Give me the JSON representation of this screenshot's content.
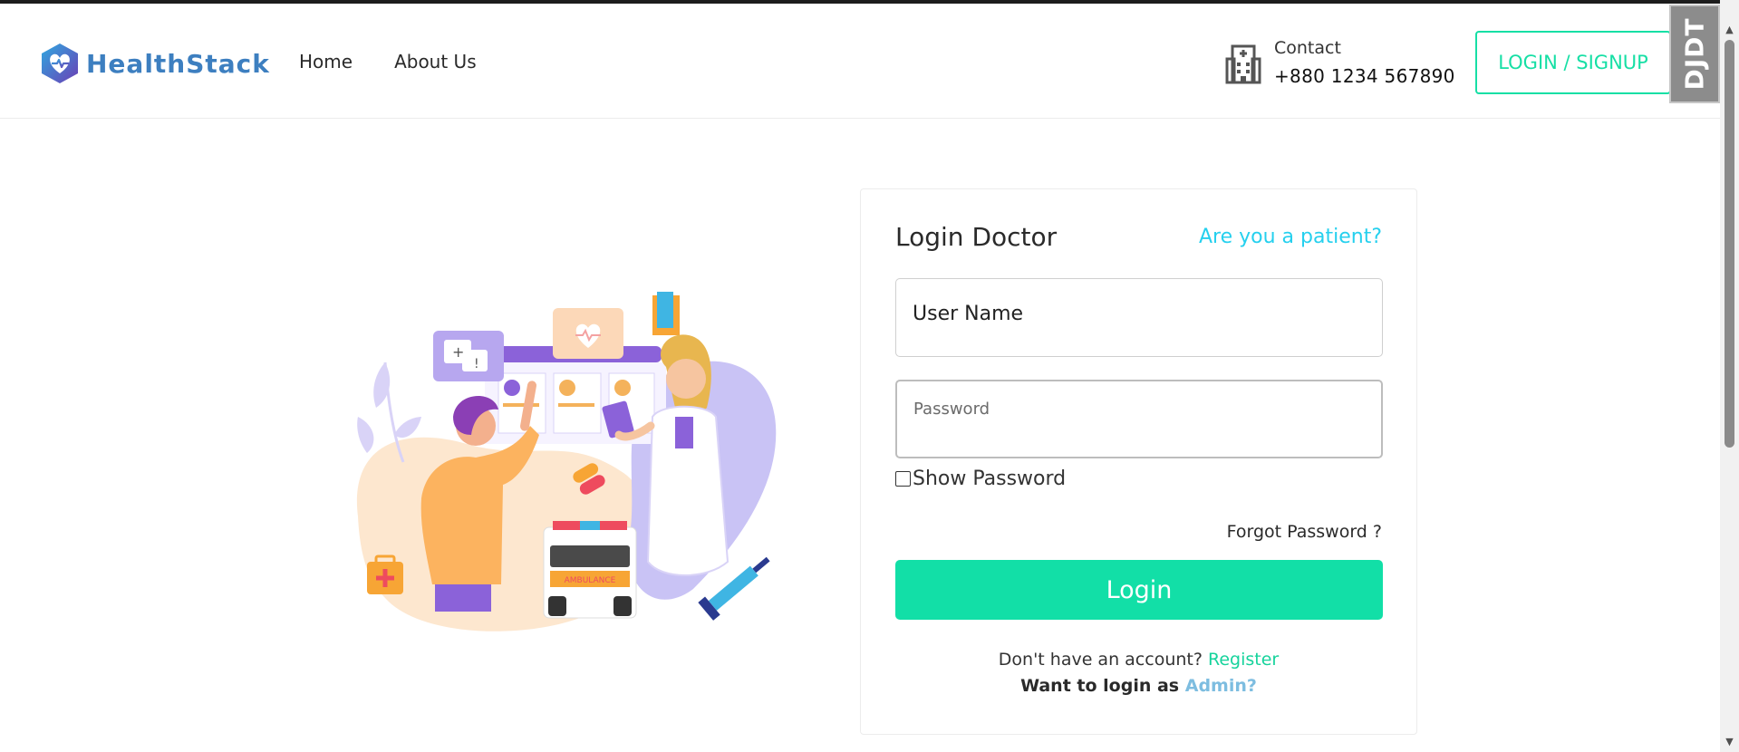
{
  "header": {
    "brand": "HealthStack",
    "nav": [
      {
        "label": "Home"
      },
      {
        "label": "About Us"
      }
    ],
    "contact_label": "Contact",
    "contact_phone": "+880 1234 567890",
    "login_signup_label": "LOGIN / SIGNUP",
    "debug_toolbar_label": "DJDT"
  },
  "illustration": {
    "ambulance_text": "AMBULANCE",
    "chat_symbols": "+ !"
  },
  "login": {
    "title": "Login Doctor",
    "patient_link": "Are you a patient?",
    "username_value": "User Name",
    "password_placeholder": "Password",
    "show_password_label": "Show Password",
    "forgot_password": "Forgot Password ?",
    "login_button": "Login",
    "no_account_text": "Don't have an account?",
    "register_link": "Register",
    "admin_prefix": "Want to login as",
    "admin_link": "Admin?"
  },
  "colors": {
    "accent_green": "#12dfa7",
    "link_cyan": "#25d0ee",
    "admin_blue": "#7dbde0",
    "brand_blue": "#3d7fc0",
    "brand_purple": "#6b3fb5"
  },
  "icons": {
    "logo": "heart-hexagon-icon",
    "contact": "hospital-building-icon",
    "scroll_up": "scroll-up-arrow-icon",
    "scroll_down": "scroll-down-arrow-icon"
  }
}
